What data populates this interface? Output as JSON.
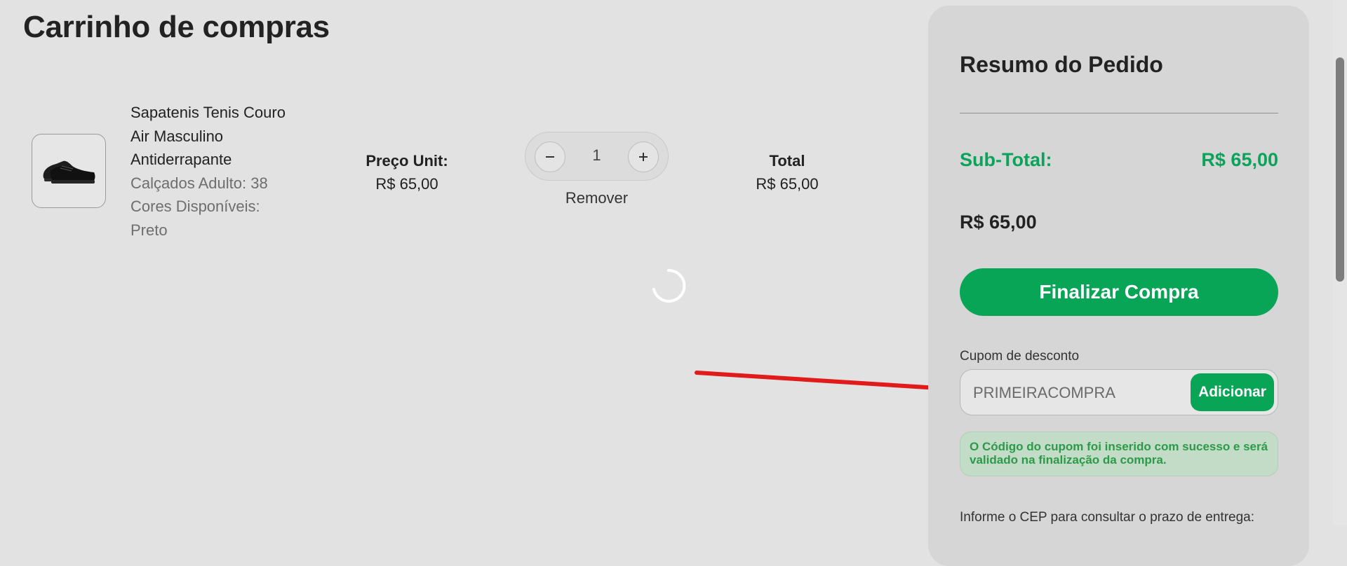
{
  "page": {
    "title": "Carrinho de compras"
  },
  "cart": {
    "item": {
      "name_lines": [
        "Sapatenis Tenis Couro",
        "Air Masculino",
        "Antiderrapante"
      ],
      "attributes": [
        "Calçados Adulto: 38",
        "Cores Disponíveis:",
        "Preto"
      ],
      "unit_price_label": "Preço Unit:",
      "unit_price": "R$ 65,00",
      "quantity": "1",
      "remove_label": "Remover",
      "total_label": "Total",
      "total": "R$ 65,00"
    }
  },
  "summary": {
    "title": "Resumo do Pedido",
    "subtotal_label": "Sub-Total:",
    "subtotal_value": "R$ 65,00",
    "grand_total": "R$ 65,00",
    "checkout_label": "Finalizar Compra",
    "coupon": {
      "label": "Cupom de desconto",
      "value": "PRIMEIRACOMPRA",
      "button_label": "Adicionar",
      "success_message": "O Código do cupom foi inserido com sucesso e será validado na finalização da compra."
    },
    "cep_label": "Informe o CEP para consultar o prazo de entrega:"
  },
  "colors": {
    "accent_green": "#08a557",
    "annotation_arrow": "#e11b1b",
    "background": "#e2e2e2"
  },
  "icons": [
    "minus-icon",
    "plus-icon",
    "loading-spinner-icon",
    "red-arrow-annotation"
  ]
}
